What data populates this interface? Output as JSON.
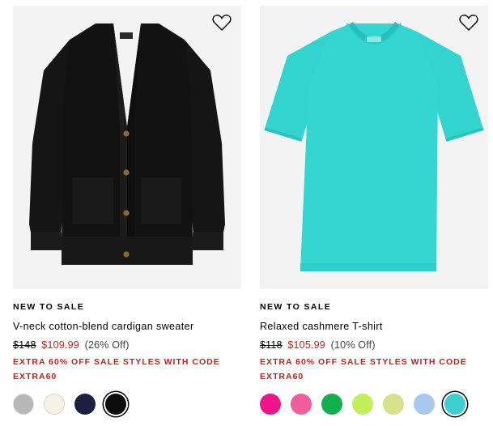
{
  "products": [
    {
      "badge": "NEW TO SALE",
      "name": "V-neck cotton-blend cardigan sweater",
      "price_original": "$148",
      "price_sale": "$109.99",
      "discount": "(26% Off)",
      "promo": "EXTRA 60% OFF SALE STYLES WITH CODE EXTRA60",
      "garment_color": "#121212",
      "swatches": [
        "#b8b8b8",
        "#f5f2e6",
        "#1c1f3f",
        "#0d0d0d"
      ],
      "selected_swatch": 3
    },
    {
      "badge": "NEW TO SALE",
      "name": "Relaxed cashmere T-shirt",
      "price_original": "$118",
      "price_sale": "$105.99",
      "discount": "(10% Off)",
      "promo": "EXTRA 60% OFF SALE STYLES WITH CODE EXTRA60",
      "garment_color": "#33d6d0",
      "swatches": [
        "#f2128a",
        "#f35c9d",
        "#0fb04d",
        "#bff05a",
        "#d5e28a",
        "#a8c8ee",
        "#3ccfd0"
      ],
      "selected_swatch": 6
    }
  ],
  "colors": {
    "sale_red": "#c8201b",
    "image_bg": "#f3f3f3"
  },
  "icons": {
    "wishlist": "heart-outline-icon"
  }
}
